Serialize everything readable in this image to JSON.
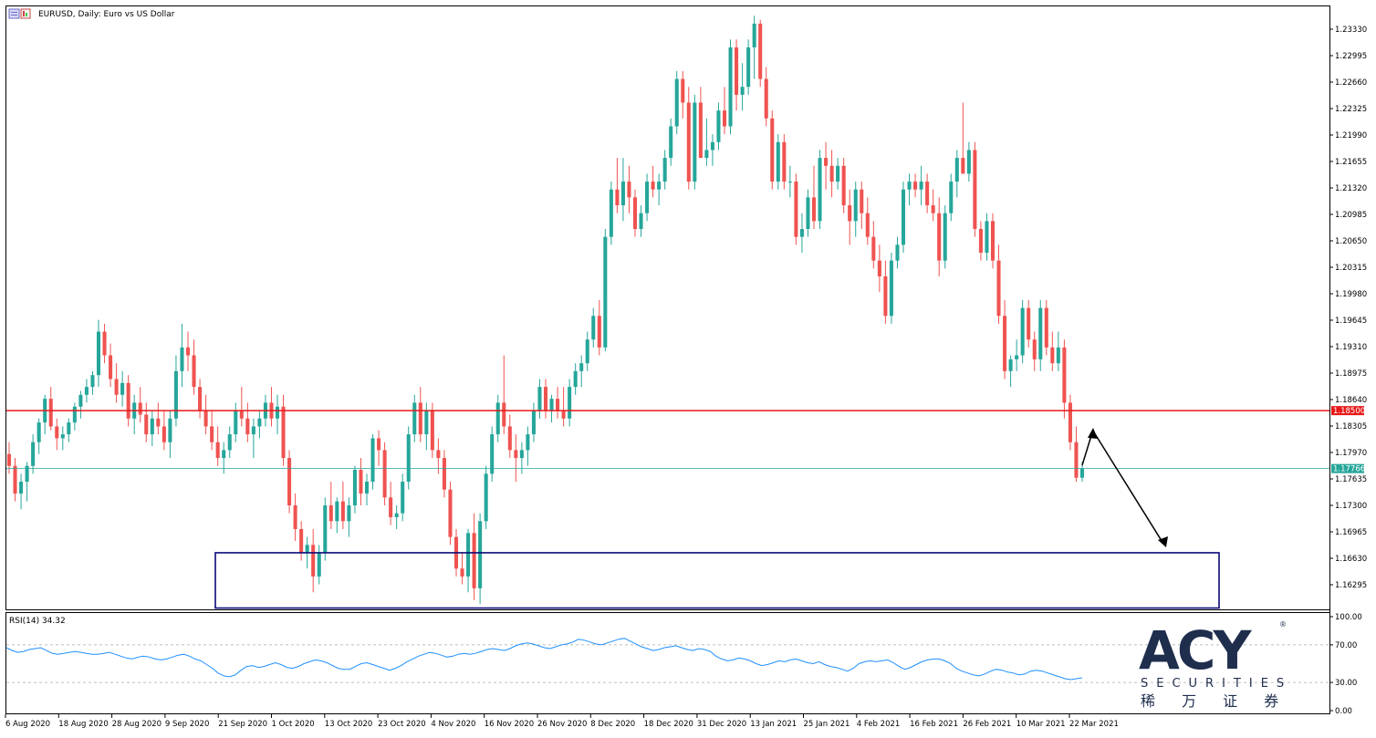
{
  "header": {
    "title": "EURUSD, Daily:  Euro vs US Dollar",
    "icon": "chart-window-icon"
  },
  "rsi": {
    "label": "RSI(14) 34.32",
    "scale_labels": [
      "100.00",
      "70.00",
      "30.00",
      "0.00"
    ],
    "levels": [
      70,
      30
    ],
    "color": "#1e90ff"
  },
  "logo": {
    "brand": "ACY",
    "sub": "SECURITIES",
    "chinese": "稀 万 证 券",
    "registered": "®",
    "color": "#1f2e4d"
  },
  "colors": {
    "bull": "#26a69a",
    "bear": "#ef5350",
    "resistance_line": "#e8191a",
    "current_price_line": "#26a69a",
    "support_box": "#0a0a78",
    "arrow": "#000000"
  },
  "chart_data": {
    "type": "candlestick",
    "symbol": "EURUSD",
    "timeframe": "Daily",
    "title": "EURUSD, Daily:  Euro vs US Dollar",
    "price_axis_ticks": [
      "1.23330",
      "1.22995",
      "1.22660",
      "1.22325",
      "1.21990",
      "1.21655",
      "1.21320",
      "1.20985",
      "1.20650",
      "1.20315",
      "1.19980",
      "1.19645",
      "1.19310",
      "1.18975",
      "1.18640",
      "1.18305",
      "1.17970",
      "1.17635",
      "1.17300",
      "1.16965",
      "1.16630",
      "1.16295"
    ],
    "ylim": [
      1.1587,
      1.2367
    ],
    "date_axis_ticks": [
      "6 Aug 2020",
      "18 Aug 2020",
      "28 Aug 2020",
      "9 Sep 2020",
      "21 Sep 2020",
      "1 Oct 2020",
      "13 Oct 2020",
      "23 Oct 2020",
      "4 Nov 2020",
      "16 Nov 2020",
      "26 Nov 2020",
      "8 Dec 2020",
      "18 Dec 2020",
      "31 Dec 2020",
      "13 Jan 2021",
      "25 Jan 2021",
      "4 Feb 2021",
      "16 Feb 2021",
      "26 Feb 2021",
      "10 Mar 2021",
      "22 Mar 2021"
    ],
    "resistance_level": {
      "value": 1.185,
      "label": "1.18500"
    },
    "current_price": {
      "value": 1.17766,
      "label": "1.17766"
    },
    "support_zone": {
      "from_date": "21 Sep 2020",
      "to_date": "after 22 Mar 2021",
      "low": 1.16,
      "high": 1.167
    },
    "candles": [
      [
        1.1795,
        1.181,
        1.177,
        1.178
      ],
      [
        1.178,
        1.179,
        1.1735,
        1.1745
      ],
      [
        1.1745,
        1.177,
        1.1725,
        1.176
      ],
      [
        1.176,
        1.1785,
        1.1735,
        1.178
      ],
      [
        1.178,
        1.182,
        1.177,
        1.181
      ],
      [
        1.181,
        1.184,
        1.1795,
        1.1835
      ],
      [
        1.1835,
        1.187,
        1.182,
        1.1865
      ],
      [
        1.1865,
        1.188,
        1.1825,
        1.183
      ],
      [
        1.183,
        1.184,
        1.18,
        1.1815
      ],
      [
        1.1815,
        1.183,
        1.18,
        1.182
      ],
      [
        1.182,
        1.184,
        1.181,
        1.1835
      ],
      [
        1.1835,
        1.186,
        1.1825,
        1.1855
      ],
      [
        1.1855,
        1.1875,
        1.184,
        1.187
      ],
      [
        1.187,
        1.189,
        1.186,
        1.188
      ],
      [
        1.188,
        1.19,
        1.187,
        1.1895
      ],
      [
        1.1895,
        1.1965,
        1.188,
        1.195
      ],
      [
        1.195,
        1.196,
        1.191,
        1.192
      ],
      [
        1.192,
        1.1935,
        1.188,
        1.189
      ],
      [
        1.189,
        1.191,
        1.186,
        1.187
      ],
      [
        1.187,
        1.19,
        1.1855,
        1.1885
      ],
      [
        1.1885,
        1.1895,
        1.183,
        1.184
      ],
      [
        1.184,
        1.187,
        1.182,
        1.186
      ],
      [
        1.186,
        1.188,
        1.1835,
        1.1845
      ],
      [
        1.1845,
        1.186,
        1.181,
        1.182
      ],
      [
        1.182,
        1.185,
        1.1805,
        1.184
      ],
      [
        1.184,
        1.186,
        1.182,
        1.183
      ],
      [
        1.183,
        1.185,
        1.18,
        1.181
      ],
      [
        1.181,
        1.185,
        1.179,
        1.184
      ],
      [
        1.184,
        1.192,
        1.183,
        1.19
      ],
      [
        1.19,
        1.196,
        1.188,
        1.193
      ],
      [
        1.193,
        1.195,
        1.19,
        1.192
      ],
      [
        1.192,
        1.194,
        1.187,
        1.188
      ],
      [
        1.188,
        1.189,
        1.184,
        1.185
      ],
      [
        1.185,
        1.187,
        1.182,
        1.183
      ],
      [
        1.183,
        1.185,
        1.18,
        1.181
      ],
      [
        1.181,
        1.183,
        1.178,
        1.179
      ],
      [
        1.179,
        1.181,
        1.177,
        1.18
      ],
      [
        1.18,
        1.183,
        1.179,
        1.182
      ],
      [
        1.182,
        1.186,
        1.181,
        1.185
      ],
      [
        1.185,
        1.188,
        1.183,
        1.184
      ],
      [
        1.184,
        1.186,
        1.181,
        1.182
      ],
      [
        1.182,
        1.184,
        1.179,
        1.183
      ],
      [
        1.183,
        1.185,
        1.1815,
        1.184
      ],
      [
        1.184,
        1.187,
        1.183,
        1.186
      ],
      [
        1.186,
        1.188,
        1.183,
        1.184
      ],
      [
        1.184,
        1.187,
        1.182,
        1.1855
      ],
      [
        1.1855,
        1.187,
        1.178,
        1.179
      ],
      [
        1.179,
        1.18,
        1.172,
        1.173
      ],
      [
        1.173,
        1.1745,
        1.1685,
        1.17
      ],
      [
        1.17,
        1.171,
        1.166,
        1.167
      ],
      [
        1.167,
        1.169,
        1.165,
        1.168
      ],
      [
        1.168,
        1.17,
        1.162,
        1.164
      ],
      [
        1.164,
        1.168,
        1.163,
        1.167
      ],
      [
        1.167,
        1.174,
        1.166,
        1.173
      ],
      [
        1.173,
        1.176,
        1.17,
        1.171
      ],
      [
        1.171,
        1.174,
        1.1695,
        1.1735
      ],
      [
        1.1735,
        1.176,
        1.17,
        1.171
      ],
      [
        1.171,
        1.174,
        1.169,
        1.173
      ],
      [
        1.173,
        1.178,
        1.172,
        1.1775
      ],
      [
        1.1775,
        1.179,
        1.173,
        1.1745
      ],
      [
        1.1745,
        1.177,
        1.173,
        1.176
      ],
      [
        1.176,
        1.182,
        1.175,
        1.1815
      ],
      [
        1.1815,
        1.1825,
        1.178,
        1.18
      ],
      [
        1.18,
        1.181,
        1.173,
        1.174
      ],
      [
        1.174,
        1.176,
        1.1705,
        1.1715
      ],
      [
        1.1715,
        1.173,
        1.17,
        1.172
      ],
      [
        1.172,
        1.177,
        1.171,
        1.176
      ],
      [
        1.176,
        1.183,
        1.175,
        1.182
      ],
      [
        1.182,
        1.187,
        1.181,
        1.186
      ],
      [
        1.186,
        1.188,
        1.181,
        1.182
      ],
      [
        1.182,
        1.186,
        1.18,
        1.185
      ],
      [
        1.185,
        1.186,
        1.179,
        1.18
      ],
      [
        1.18,
        1.1815,
        1.177,
        1.179
      ],
      [
        1.179,
        1.18,
        1.174,
        1.175
      ],
      [
        1.175,
        1.176,
        1.168,
        1.169
      ],
      [
        1.169,
        1.17,
        1.164,
        1.165
      ],
      [
        1.165,
        1.167,
        1.163,
        1.164
      ],
      [
        1.164,
        1.17,
        1.162,
        1.1695
      ],
      [
        1.1695,
        1.172,
        1.161,
        1.1625
      ],
      [
        1.1625,
        1.172,
        1.1605,
        1.171
      ],
      [
        1.171,
        1.178,
        1.17,
        1.177
      ],
      [
        1.177,
        1.183,
        1.176,
        1.182
      ],
      [
        1.182,
        1.187,
        1.181,
        1.186
      ],
      [
        1.186,
        1.192,
        1.182,
        1.183
      ],
      [
        1.183,
        1.1845,
        1.179,
        1.18
      ],
      [
        1.18,
        1.182,
        1.176,
        1.179
      ],
      [
        1.179,
        1.181,
        1.177,
        1.18
      ],
      [
        1.18,
        1.183,
        1.178,
        1.182
      ],
      [
        1.182,
        1.186,
        1.181,
        1.185
      ],
      [
        1.185,
        1.189,
        1.184,
        1.188
      ],
      [
        1.188,
        1.189,
        1.184,
        1.185
      ],
      [
        1.185,
        1.187,
        1.1835,
        1.1865
      ],
      [
        1.1865,
        1.188,
        1.184,
        1.185
      ],
      [
        1.185,
        1.188,
        1.183,
        1.184
      ],
      [
        1.184,
        1.189,
        1.183,
        1.188
      ],
      [
        1.188,
        1.191,
        1.187,
        1.19
      ],
      [
        1.19,
        1.192,
        1.188,
        1.191
      ],
      [
        1.191,
        1.195,
        1.19,
        1.194
      ],
      [
        1.194,
        1.198,
        1.193,
        1.197
      ],
      [
        1.197,
        1.199,
        1.192,
        1.193
      ],
      [
        1.193,
        1.208,
        1.1925,
        1.207
      ],
      [
        1.207,
        1.214,
        1.206,
        1.213
      ],
      [
        1.213,
        1.217,
        1.21,
        1.211
      ],
      [
        1.211,
        1.217,
        1.209,
        1.214
      ],
      [
        1.214,
        1.216,
        1.21,
        1.212
      ],
      [
        1.212,
        1.213,
        1.207,
        1.208
      ],
      [
        1.208,
        1.211,
        1.207,
        1.21
      ],
      [
        1.21,
        1.215,
        1.209,
        1.214
      ],
      [
        1.214,
        1.216,
        1.212,
        1.213
      ],
      [
        1.213,
        1.215,
        1.211,
        1.214
      ],
      [
        1.214,
        1.218,
        1.213,
        1.217
      ],
      [
        1.217,
        1.222,
        1.216,
        1.221
      ],
      [
        1.221,
        1.228,
        1.22,
        1.227
      ],
      [
        1.227,
        1.228,
        1.222,
        1.224
      ],
      [
        1.224,
        1.226,
        1.213,
        1.214
      ],
      [
        1.214,
        1.225,
        1.213,
        1.224
      ],
      [
        1.224,
        1.226,
        1.218,
        1.217
      ],
      [
        1.217,
        1.222,
        1.216,
        1.218
      ],
      [
        1.218,
        1.22,
        1.216,
        1.219
      ],
      [
        1.219,
        1.224,
        1.218,
        1.223
      ],
      [
        1.223,
        1.226,
        1.22,
        1.221
      ],
      [
        1.221,
        1.232,
        1.22,
        1.231
      ],
      [
        1.231,
        1.232,
        1.223,
        1.225
      ],
      [
        1.225,
        1.229,
        1.223,
        1.226
      ],
      [
        1.226,
        1.232,
        1.225,
        1.231
      ],
      [
        1.231,
        1.235,
        1.227,
        1.234
      ],
      [
        1.234,
        1.2345,
        1.226,
        1.227
      ],
      [
        1.227,
        1.2285,
        1.221,
        1.222
      ],
      [
        1.222,
        1.223,
        1.213,
        1.214
      ],
      [
        1.214,
        1.22,
        1.213,
        1.219
      ],
      [
        1.219,
        1.22,
        1.213,
        1.214
      ],
      [
        1.214,
        1.216,
        1.212,
        1.214
      ],
      [
        1.214,
        1.215,
        1.206,
        1.207
      ],
      [
        1.207,
        1.21,
        1.205,
        1.208
      ],
      [
        1.208,
        1.213,
        1.207,
        1.212
      ],
      [
        1.212,
        1.216,
        1.208,
        1.209
      ],
      [
        1.209,
        1.218,
        1.208,
        1.217
      ],
      [
        1.217,
        1.219,
        1.213,
        1.216
      ],
      [
        1.216,
        1.218,
        1.212,
        1.214
      ],
      [
        1.214,
        1.217,
        1.213,
        1.216
      ],
      [
        1.216,
        1.217,
        1.21,
        1.211
      ],
      [
        1.211,
        1.213,
        1.206,
        1.209
      ],
      [
        1.209,
        1.214,
        1.207,
        1.213
      ],
      [
        1.213,
        1.214,
        1.208,
        1.21
      ],
      [
        1.21,
        1.212,
        1.206,
        1.207
      ],
      [
        1.207,
        1.209,
        1.203,
        1.204
      ],
      [
        1.204,
        1.206,
        1.2,
        1.202
      ],
      [
        1.202,
        1.204,
        1.196,
        1.197
      ],
      [
        1.197,
        1.205,
        1.196,
        1.204
      ],
      [
        1.204,
        1.207,
        1.203,
        1.206
      ],
      [
        1.206,
        1.214,
        1.205,
        1.213
      ],
      [
        1.213,
        1.215,
        1.211,
        1.214
      ],
      [
        1.214,
        1.215,
        1.212,
        1.213
      ],
      [
        1.213,
        1.216,
        1.211,
        1.214
      ],
      [
        1.214,
        1.215,
        1.21,
        1.211
      ],
      [
        1.211,
        1.213,
        1.209,
        1.21
      ],
      [
        1.21,
        1.212,
        1.202,
        1.204
      ],
      [
        1.204,
        1.211,
        1.203,
        1.21
      ],
      [
        1.21,
        1.215,
        1.209,
        1.214
      ],
      [
        1.214,
        1.218,
        1.212,
        1.217
      ],
      [
        1.217,
        1.224,
        1.216,
        1.215
      ],
      [
        1.215,
        1.219,
        1.214,
        1.218
      ],
      [
        1.218,
        1.219,
        1.207,
        1.208
      ],
      [
        1.208,
        1.209,
        1.204,
        1.205
      ],
      [
        1.205,
        1.21,
        1.204,
        1.209
      ],
      [
        1.209,
        1.21,
        1.203,
        1.204
      ],
      [
        1.204,
        1.206,
        1.196,
        1.197
      ],
      [
        1.197,
        1.199,
        1.189,
        1.19
      ],
      [
        1.19,
        1.192,
        1.188,
        1.1915
      ],
      [
        1.1915,
        1.194,
        1.19,
        1.192
      ],
      [
        1.192,
        1.199,
        1.191,
        1.198
      ],
      [
        1.198,
        1.199,
        1.193,
        1.194
      ],
      [
        1.194,
        1.195,
        1.19,
        1.1915
      ],
      [
        1.1915,
        1.199,
        1.19,
        1.198
      ],
      [
        1.198,
        1.199,
        1.192,
        1.193
      ],
      [
        1.193,
        1.195,
        1.19,
        1.191
      ],
      [
        1.191,
        1.195,
        1.19,
        1.193
      ],
      [
        1.193,
        1.194,
        1.184,
        1.186
      ],
      [
        1.186,
        1.187,
        1.18,
        1.181
      ],
      [
        1.181,
        1.183,
        1.176,
        1.1765
      ],
      [
        1.1765,
        1.1785,
        1.176,
        1.1777
      ]
    ],
    "rsi_values": [
      67,
      64,
      62,
      63,
      65,
      66,
      67,
      64,
      61,
      60,
      61,
      62,
      63,
      62,
      61,
      60,
      60,
      61,
      62,
      60,
      58,
      56,
      55,
      57,
      58,
      57,
      55,
      54,
      55,
      57,
      59,
      60,
      58,
      55,
      53,
      49,
      45,
      40,
      37,
      36,
      38,
      43,
      47,
      48,
      46,
      47,
      49,
      51,
      49,
      46,
      45,
      47,
      50,
      52,
      54,
      53,
      51,
      48,
      45,
      44,
      44,
      47,
      50,
      51,
      49,
      47,
      45,
      43,
      45,
      48,
      52,
      55,
      58,
      60,
      62,
      61,
      59,
      57,
      58,
      60,
      61,
      60,
      61,
      63,
      65,
      66,
      65,
      64,
      66,
      69,
      71,
      72,
      71,
      69,
      67,
      66,
      68,
      70,
      71,
      73,
      76,
      75,
      73,
      71,
      70,
      72,
      74,
      76,
      77,
      74,
      71,
      68,
      66,
      64,
      65,
      67,
      68,
      69,
      67,
      65,
      64,
      66,
      65,
      63,
      58,
      55,
      53,
      54,
      56,
      55,
      53,
      50,
      48,
      49,
      51,
      53,
      52,
      54,
      55,
      53,
      51,
      50,
      52,
      49,
      47,
      46,
      44,
      42,
      45,
      50,
      52,
      53,
      52,
      53,
      54,
      51,
      47,
      44,
      46,
      49,
      52,
      54,
      55,
      55,
      53,
      50,
      45,
      42,
      40,
      38,
      37,
      39,
      42,
      44,
      43,
      41,
      40,
      38,
      39,
      42,
      43,
      42,
      40,
      38,
      36,
      34,
      33,
      34,
      35
    ]
  }
}
